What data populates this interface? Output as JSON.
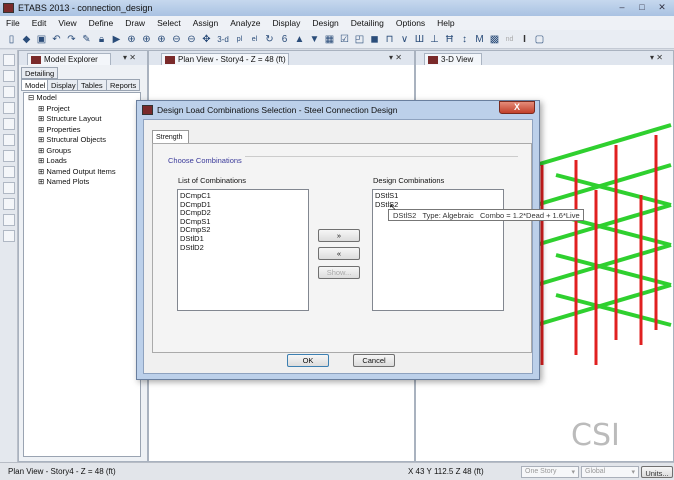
{
  "app": {
    "title": "ETABS 2013 - connection_design"
  },
  "menu": [
    "File",
    "Edit",
    "View",
    "Define",
    "Draw",
    "Select",
    "Assign",
    "Analyze",
    "Display",
    "Design",
    "Detailing",
    "Options",
    "Help"
  ],
  "toolbar": {
    "view_3d": "3-d",
    "plan": "pl",
    "elev": "el",
    "nd": "nd",
    "section": "I"
  },
  "panes": {
    "explorer": "Model Explorer",
    "plan": "Plan View - Story4 - Z = 48 (ft)",
    "view3d": "3-D View"
  },
  "explorer": {
    "detailing_tab": "Detailing",
    "tabs": [
      "Model",
      "Display",
      "Tables",
      "Reports"
    ],
    "root": "Model",
    "items": [
      "Project",
      "Structure Layout",
      "Properties",
      "Structural Objects",
      "Groups",
      "Loads",
      "Named Output Items",
      "Named Plots"
    ]
  },
  "dialog": {
    "title": "Design Load Combinations Selection - Steel Connection Design",
    "tab": "Strength",
    "group": "Choose Combinations",
    "list_label": "List of Combinations",
    "design_label": "Design Combinations",
    "list": [
      "DCmpC1",
      "DCmpD1",
      "DCmpD2",
      "DCmpS1",
      "DCmpS2",
      "DStlD1",
      "DStlD2"
    ],
    "design": [
      "DStlS1",
      "DStlS2"
    ],
    "add": "»",
    "remove": "«",
    "show": "Show...",
    "ok": "OK",
    "cancel": "Cancel",
    "close": "X"
  },
  "tooltip": "DStlS2   Type: Algebraic   Combo = 1.2*Dead + 1.6*Live",
  "status": {
    "left": "Plan View - Story4 - Z = 48 (ft)",
    "coords": "X 43  Y 112.5  Z 48 (ft)",
    "story": "One Story",
    "coord_sys": "Global",
    "units": "Units..."
  },
  "colors": {
    "beam": "#2fd02f",
    "column": "#e02020"
  }
}
